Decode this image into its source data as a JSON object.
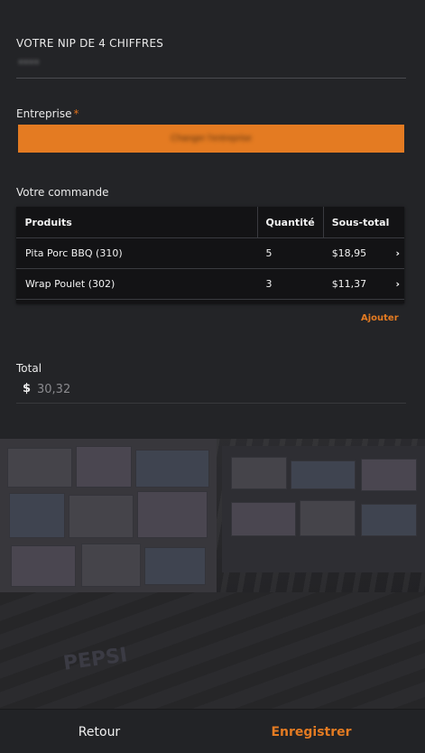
{
  "nip": {
    "label": "VOTRE NIP DE 4 CHIFFRES",
    "value": "••••"
  },
  "company": {
    "label": "Entreprise",
    "required_marker": "*",
    "button_label": "Changer l'entreprise"
  },
  "order": {
    "label": "Votre commande",
    "headers": [
      "Produits",
      "Quantité",
      "Sous-total"
    ],
    "rows": [
      {
        "product": "Pita Porc BBQ (310)",
        "quantity": "5",
        "subtotal": "$18,95"
      },
      {
        "product": "Wrap Poulet (302)",
        "quantity": "3",
        "subtotal": "$11,37"
      }
    ],
    "row_chevron": "›",
    "add_label": "Ajouter"
  },
  "total": {
    "label": "Total",
    "currency": "$",
    "value": "30,32"
  },
  "footer": {
    "back_label": "Retour",
    "save_label": "Enregistrer"
  },
  "colors": {
    "accent": "#e47b22",
    "background": "#232427",
    "table_background": "#131315"
  }
}
